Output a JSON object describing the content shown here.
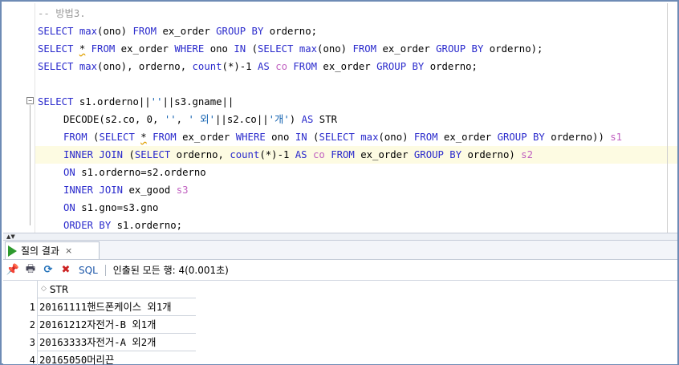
{
  "editor": {
    "lines": {
      "l1": {
        "cm": "-- 방법3."
      },
      "l2": {
        "a": "SELECT ",
        "b": "max",
        "c": "(ono) ",
        "d": "FROM",
        "e": " ex_order ",
        "f": "GROUP BY",
        "g": " orderno;"
      },
      "l3": {
        "a": "SELECT ",
        "b": "*",
        "c": " ",
        "d": "FROM",
        "e": " ex_order ",
        "f": "WHERE",
        "g": " ono ",
        "h": "IN",
        "i": " (",
        "j": "SELECT ",
        "k": "max",
        "l": "(ono) ",
        "m": "FROM",
        "n": " ex_order ",
        "o": "GROUP BY",
        "p": " orderno);"
      },
      "l4": {
        "a": "SELECT ",
        "b": "max",
        "c": "(ono), orderno, ",
        "d": "count",
        "e": "(*)-1 ",
        "f": "AS",
        "g": " ",
        "h": "co",
        "i": " ",
        "j": "FROM",
        "k": " ex_order ",
        "l": "GROUP BY",
        "m": " orderno;"
      },
      "l5": {
        "a": "SELECT",
        "b": " s1.orderno||",
        "c": "''",
        "d": "||s3.gname||"
      },
      "l6": {
        "a": "DECODE(s2.co, 0, ",
        "b": "''",
        "c": ", ",
        "d": "' 외'",
        "e": "||s2.co||",
        "f": "'개'",
        "g": ") ",
        "h": "AS",
        "i": " STR"
      },
      "l7": {
        "a": "FROM",
        "b": " (",
        "c": "SELECT ",
        "d": "*",
        "e": " ",
        "f": "FROM",
        "g": " ex_order ",
        "h": "WHERE",
        "i": " ono ",
        "j": "IN",
        "k": " (",
        "l": "SELECT ",
        "m": "max",
        "n": "(ono) ",
        "o": "FROM",
        "p": " ex_order ",
        "q": "GROUP BY",
        "r": " orderno)) ",
        "s": "s1"
      },
      "l8": {
        "a": "INNER JOIN",
        "b": " (",
        "c": "SELECT",
        "d": " orderno, ",
        "e": "count",
        "f": "(*)-1 ",
        "g": "AS",
        "h": " ",
        "i": "co",
        "j": " ",
        "k": "FROM",
        "l": " ex_order ",
        "m": "GROUP BY",
        "n": " orderno) ",
        "o": "s2"
      },
      "l9": {
        "a": "ON",
        "b": " s1.orderno=s2.orderno"
      },
      "l10": {
        "a": "INNER JOIN",
        "b": " ex_good ",
        "c": "s3"
      },
      "l11": {
        "a": "ON",
        "b": " s1.gno=s3.gno"
      },
      "l12": {
        "a": "ORDER BY",
        "b": " s1.orderno;"
      }
    }
  },
  "results_tab": {
    "label": "질의 결과",
    "close": "×"
  },
  "toolbar": {
    "sql_label": "SQL",
    "status": "인출된 모든 행: 4(0.001초)"
  },
  "grid": {
    "column": "STR",
    "rows": [
      {
        "num": "1",
        "value": "20161111핸드폰케이스 외1개"
      },
      {
        "num": "2",
        "value": "20161212자전거-B 외1개"
      },
      {
        "num": "3",
        "value": "20163333자전거-A 외2개"
      },
      {
        "num": "4",
        "value": "20165050머리끈"
      }
    ]
  },
  "colors": {
    "keyword": "#2a2acc",
    "alias": "#c060c0",
    "comment": "#9a9a9a",
    "string": "#1060b0",
    "frame": "#6e8bb5"
  }
}
